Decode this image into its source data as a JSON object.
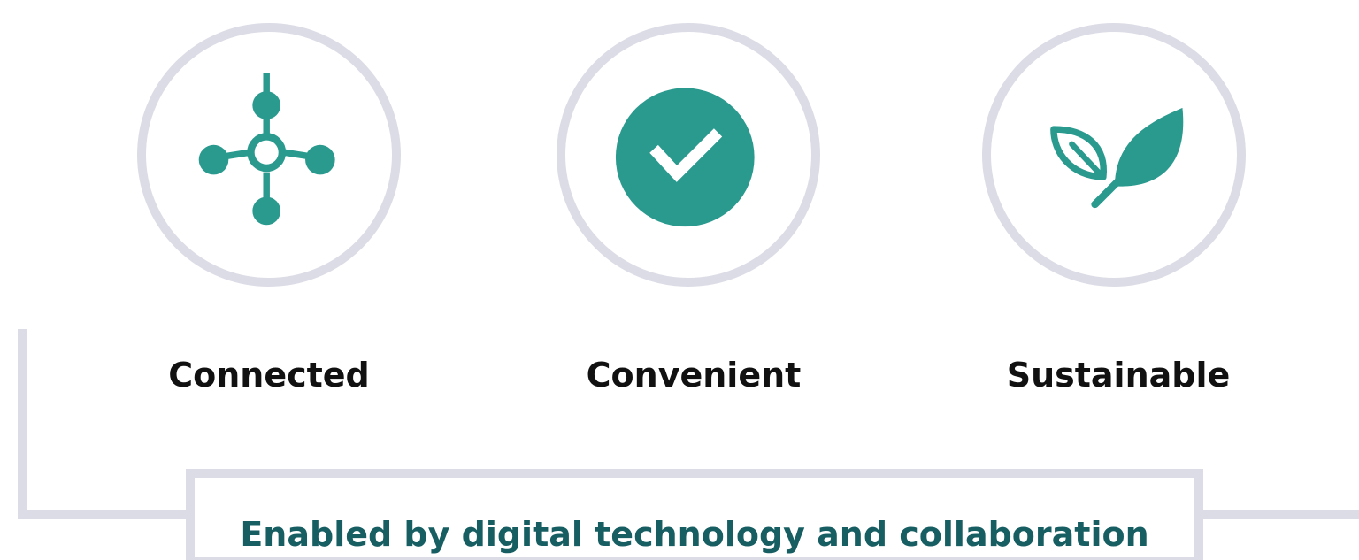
{
  "pillars": [
    {
      "label": "Connected",
      "icon": "network-hub-icon"
    },
    {
      "label": "Convenient",
      "icon": "checkmark-circle-icon"
    },
    {
      "label": "Sustainable",
      "icon": "leaf-icon"
    }
  ],
  "banner": {
    "text": "Enabled by digital technology and collaboration"
  },
  "colors": {
    "accent": "#2a9a8f",
    "ring": "#dcdce6",
    "label_text": "#111111",
    "banner_text": "#175e62",
    "background": "#ffffff"
  }
}
